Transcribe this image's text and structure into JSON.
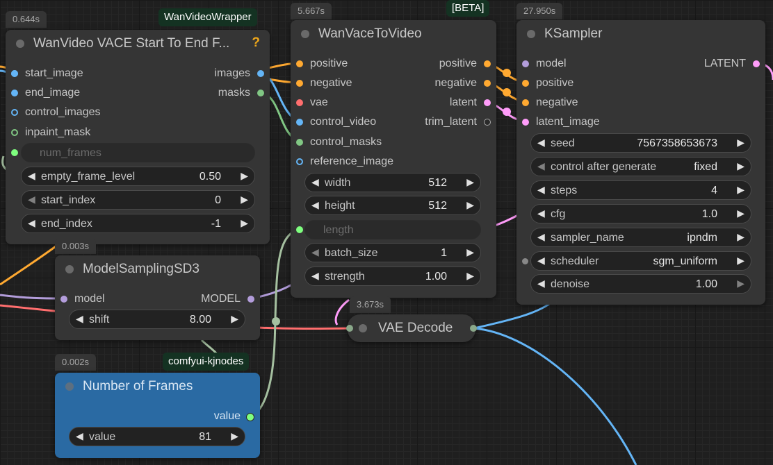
{
  "colors": {
    "canvas": "#1f1f1f",
    "node": "#353535",
    "node_blue": "#2a6aa3",
    "conditioning": "#ffa931",
    "image": "#64b5f6",
    "mask": "#81c784",
    "vae": "#ff6e6e",
    "latent": "#ff9cf9",
    "model": "#b39ddb",
    "int": "#a5c0a0",
    "widget_pin": "#7fff7f"
  },
  "vace_start_end": {
    "timing": "0.644s",
    "tag": "WanVideoWrapper",
    "title": "WanVideo VACE Start To End F...",
    "help": "?",
    "inputs": [
      "start_image",
      "end_image",
      "control_images",
      "inpaint_mask",
      "num_frames"
    ],
    "outputs": [
      "images",
      "masks"
    ],
    "widgets": [
      {
        "label": "empty_frame_level",
        "value": "0.50"
      },
      {
        "label": "start_index",
        "value": "0"
      },
      {
        "label": "end_index",
        "value": "-1"
      }
    ]
  },
  "wan_vace_to_video": {
    "timing": "5.667s",
    "tag": "[BETA]",
    "title": "WanVaceToVideo",
    "inputs": [
      "positive",
      "negative",
      "vae",
      "control_video",
      "control_masks",
      "reference_image",
      "length"
    ],
    "outputs": [
      "positive",
      "negative",
      "latent",
      "trim_latent"
    ],
    "widgets": [
      {
        "label": "width",
        "value": "512"
      },
      {
        "label": "height",
        "value": "512"
      },
      {
        "label": "batch_size",
        "value": "1"
      },
      {
        "label": "strength",
        "value": "1.00"
      }
    ]
  },
  "ksampler": {
    "timing": "27.950s",
    "title": "KSampler",
    "inputs": [
      "model",
      "positive",
      "negative",
      "latent_image"
    ],
    "outputs": [
      "LATENT"
    ],
    "widgets": [
      {
        "label": "seed",
        "value": "7567358653673"
      },
      {
        "label": "control after generate",
        "value": "fixed"
      },
      {
        "label": "steps",
        "value": "4"
      },
      {
        "label": "cfg",
        "value": "1.0"
      },
      {
        "label": "sampler_name",
        "value": "ipndm"
      },
      {
        "label": "scheduler",
        "value": "sgm_uniform"
      },
      {
        "label": "denoise",
        "value": "1.00"
      }
    ]
  },
  "model_sampling": {
    "timing": "0.003s",
    "title": "ModelSamplingSD3",
    "inputs": [
      "model"
    ],
    "outputs": [
      "MODEL"
    ],
    "widgets": [
      {
        "label": "shift",
        "value": "8.00"
      }
    ]
  },
  "vae_decode": {
    "timing": "3.673s",
    "title": "VAE Decode"
  },
  "number_of_frames": {
    "timing": "0.002s",
    "tag": "comfyui-kjnodes",
    "title": "Number of Frames",
    "outputs": [
      "value"
    ],
    "widgets": [
      {
        "label": "value",
        "value": "81"
      }
    ]
  },
  "icons": {
    "arrow_left": "◀",
    "arrow_right": "▶"
  }
}
